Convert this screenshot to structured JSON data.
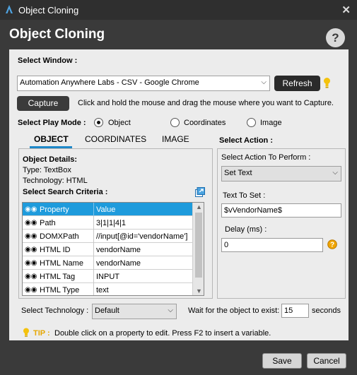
{
  "window": {
    "title": "Object Cloning",
    "close_glyph": "✕"
  },
  "header": {
    "heading": "Object Cloning",
    "help_glyph": "?"
  },
  "select_window": {
    "label": "Select Window :",
    "value": "Automation Anywhere Labs - CSV - Google Chrome",
    "refresh_label": "Refresh"
  },
  "capture": {
    "button_label": "Capture",
    "hint": "Click and hold the mouse and drag the mouse where you want to Capture."
  },
  "play_mode": {
    "label": "Select Play Mode :",
    "options": [
      "Object",
      "Coordinates",
      "Image"
    ],
    "selected": "Object"
  },
  "tabs": [
    "OBJECT",
    "COORDINATES",
    "IMAGE"
  ],
  "active_tab": "OBJECT",
  "object_details": {
    "heading": "Object Details:",
    "type_line": "Type:  TextBox",
    "tech_line": "Technology:  HTML"
  },
  "search_criteria": {
    "heading": "Select Search Criteria :",
    "columns": [
      "Property",
      "Value"
    ],
    "rows": [
      {
        "property": "Path",
        "value": "3|1|1|4|1"
      },
      {
        "property": "DOMXPath",
        "value": "//input[@id='vendorName']"
      },
      {
        "property": "HTML ID",
        "value": "vendorName"
      },
      {
        "property": "HTML Name",
        "value": "vendorName"
      },
      {
        "property": "HTML Tag",
        "value": "INPUT"
      },
      {
        "property": "HTML Type",
        "value": "text"
      }
    ]
  },
  "action": {
    "heading": "Select Action :",
    "perform_label": "Select Action To Perform :",
    "perform_value": "Set Text",
    "text_label": "Text To Set :",
    "text_value": "$vVendorName$",
    "delay_label": "Delay (ms) :",
    "delay_value": "0"
  },
  "technology": {
    "label": "Select Technology :",
    "value": "Default"
  },
  "wait": {
    "label": "Wait for the object to exist:",
    "value": "15",
    "unit": "seconds"
  },
  "tip": {
    "label": "TIP :",
    "text": "Double click on a property to edit. Press F2 to insert a variable."
  },
  "footer": {
    "save_label": "Save",
    "cancel_label": "Cancel"
  },
  "colors": {
    "accent": "#1e9bdc",
    "tip": "#e6a700",
    "bulb": "#f4c20d"
  },
  "icons": [
    "app-logo-icon",
    "close-icon",
    "help-icon",
    "lightbulb-icon",
    "chevron-down-icon",
    "binoculars-icon",
    "export-icon",
    "question-icon"
  ]
}
